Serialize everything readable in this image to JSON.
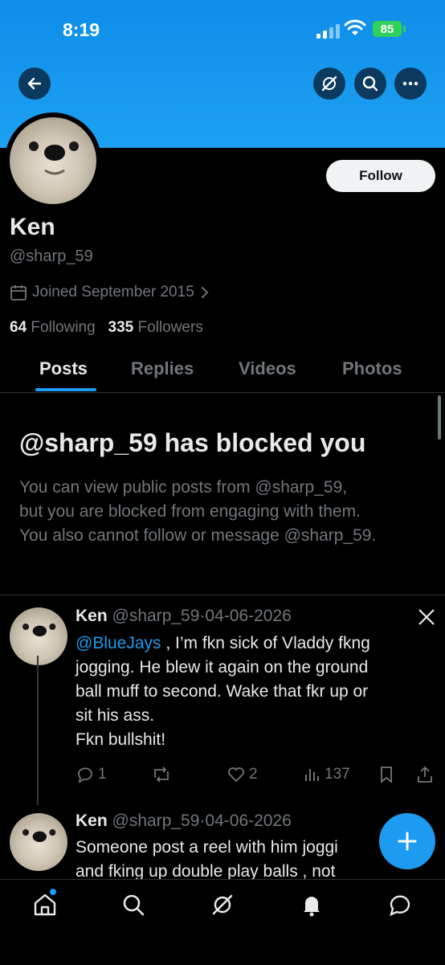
{
  "status": {
    "time": "8:19",
    "battery": "85"
  },
  "profile": {
    "name": "Ken",
    "handle": "@sharp_59",
    "joined": "Joined September 2015",
    "following_count": "64",
    "following_label": "Following",
    "followers_count": "335",
    "followers_label": "Followers",
    "follow_label": "Follow"
  },
  "tabs": [
    {
      "label": "Posts",
      "active": true
    },
    {
      "label": "Replies",
      "active": false
    },
    {
      "label": "Videos",
      "active": false
    },
    {
      "label": "Photos",
      "active": false
    }
  ],
  "blocked": {
    "title": "@sharp_59 has blocked you",
    "line1": "You can view public posts from @sharp_59,",
    "line2": "but you are blocked from engaging with them.",
    "line3": "You also cannot follow or message @sharp_59."
  },
  "posts": [
    {
      "name": "Ken",
      "handle": "@sharp_59",
      "date": "04-06-2026",
      "mention": "@BlueJays",
      "line1_rest": " , I’m fkn sick of Vladdy fkng",
      "line2": "jogging. He blew it again on the ground",
      "line3": "ball muff to second.  Wake that fkr up or",
      "line4": "sit his ass.",
      "line5": "Fkn bullshit!",
      "replies": "1",
      "likes": "2",
      "views": "137"
    },
    {
      "name": "Ken",
      "handle": "@sharp_59",
      "date": "04-06-2026",
      "line1": "Someone post a reel with him joggi",
      "line2": "and fking  up double play balls , not"
    }
  ],
  "colors": {
    "accent": "#1d9bf0",
    "banner": "#1da1f2",
    "muted": "#71767b"
  }
}
